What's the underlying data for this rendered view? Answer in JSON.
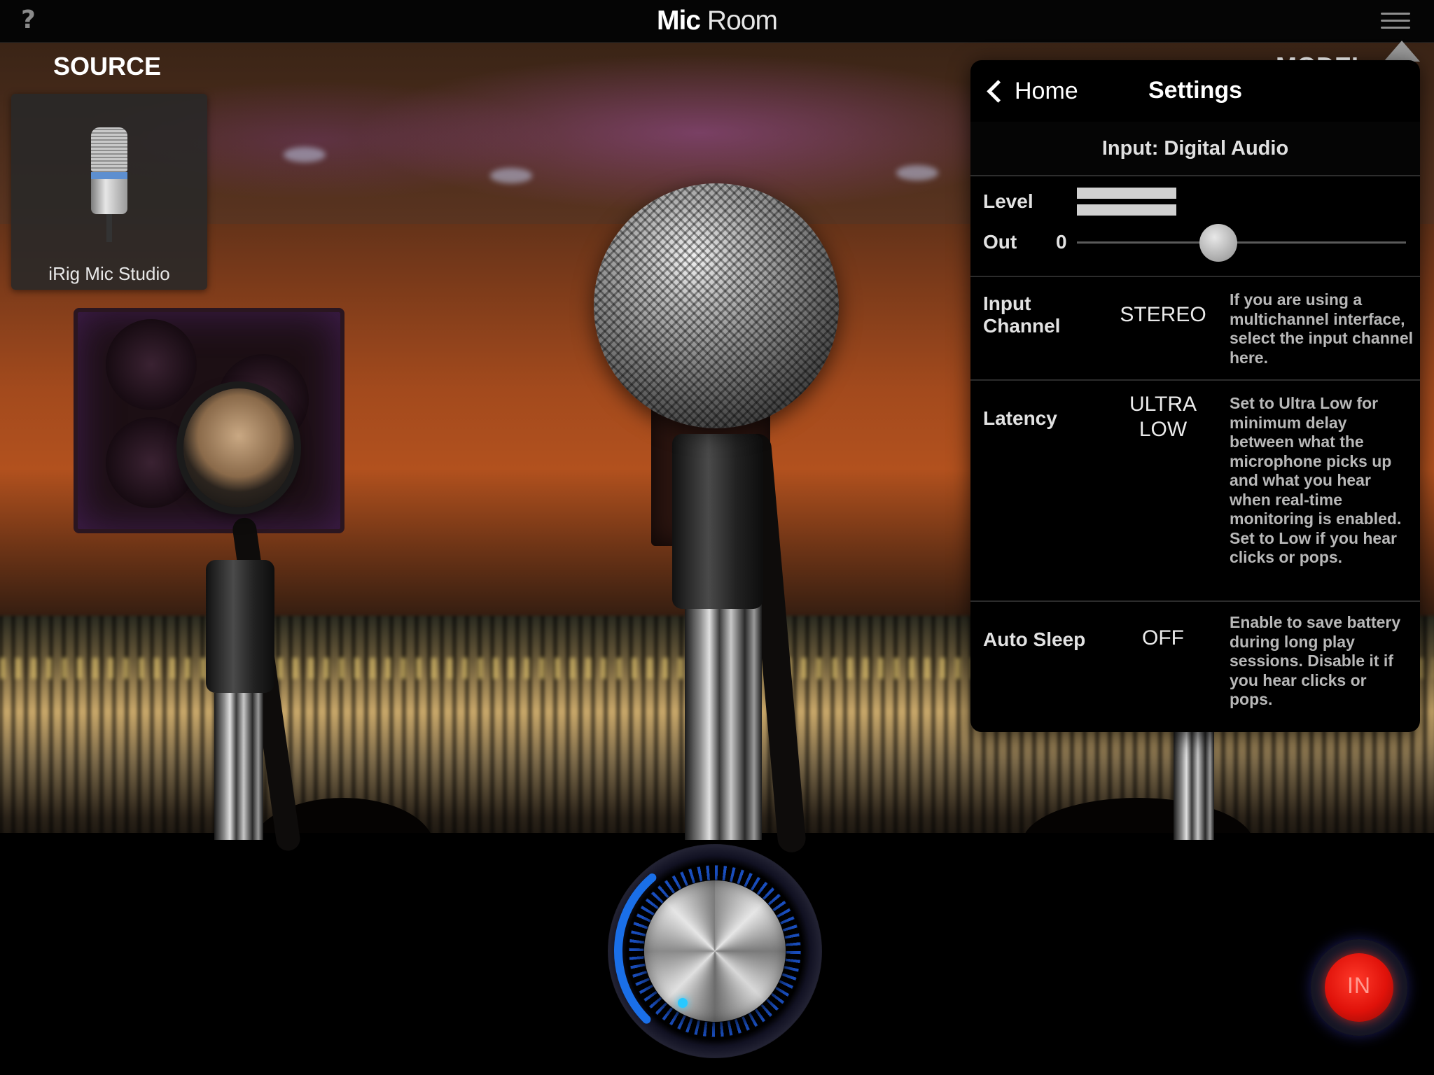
{
  "header": {
    "title_bold": "Mic",
    "title_light": "Room"
  },
  "icons": {
    "help": "?",
    "menu": "hamburger-menu"
  },
  "source": {
    "label": "SOURCE",
    "mic_name": "iRig Mic Studio"
  },
  "model": {
    "label": "MODEL"
  },
  "settings": {
    "back_label": "Home",
    "title": "Settings",
    "input_header": "Input: Digital Audio",
    "level": {
      "label": "Level",
      "out_label": "Out",
      "out_value": "0",
      "slider_fraction": 0.43
    },
    "rows": [
      {
        "label_line1": "Input",
        "label_line2": "Channel",
        "value_line1": "STEREO",
        "value_line2": "",
        "description": "If you are using a multichannel interface, select the input channel here."
      },
      {
        "label_line1": "Latency",
        "label_line2": "",
        "value_line1": "ULTRA",
        "value_line2": "LOW",
        "description": "Set to Ultra Low for minimum delay between what the microphone picks up and what you hear when real-time monitoring is enabled.  Set to Low if you hear clicks or pops."
      },
      {
        "label_line1": "Auto Sleep",
        "label_line2": "",
        "value_line1": "OFF",
        "value_line2": "",
        "description": "Enable to save battery during long play sessions. Disable it if you hear clicks or pops."
      }
    ]
  },
  "controls": {
    "in_button": "IN",
    "knob_level_fraction": 0.35
  },
  "colors": {
    "accent_blue": "#1a6fe8",
    "in_red": "#e0120a"
  }
}
